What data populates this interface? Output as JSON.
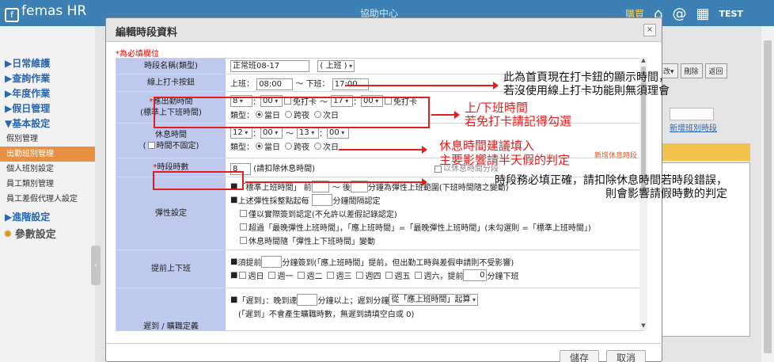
{
  "header": {
    "logo": "femas HR",
    "center": "協助中心",
    "shop": "購買",
    "user": "TEST"
  },
  "sidebar": {
    "items": [
      {
        "label": "▶日常維護"
      },
      {
        "label": "▶查詢作業"
      },
      {
        "label": "▶年度作業"
      },
      {
        "label": "▶假日管理"
      },
      {
        "label": "▼基本設定"
      }
    ],
    "subs": [
      {
        "label": "假別管理",
        "active": false
      },
      {
        "label": "出勤班別管理",
        "active": true
      },
      {
        "label": "個人班別設定",
        "active": false
      },
      {
        "label": "員工類別管理",
        "active": false
      },
      {
        "label": "員工差假代理人設定",
        "active": false
      }
    ],
    "after": {
      "label": "▶進階設定"
    },
    "param": {
      "label": "參數設定"
    }
  },
  "background": {
    "buttons": [
      "確認修改▾",
      "刪除",
      "返回"
    ],
    "link": "新增班別時段"
  },
  "modal": {
    "title": "編輯時段資料",
    "close": "×",
    "required_note": "*為必填欄位",
    "save": "儲存",
    "cancel": "取消"
  },
  "form": {
    "name": {
      "label": "時段名稱(類型)",
      "value": "正常班08-17",
      "type": "上班"
    },
    "punch": {
      "label": "線上打卡按鈕",
      "on_label": "上班：",
      "on_value": "08:00",
      "tilde": "～",
      "off_label": "下班：",
      "off_value": "17:00"
    },
    "required_time": {
      "star": "*",
      "label": "應出勤時間",
      "sub": "(標準上下班時間)",
      "start_h": "8",
      "start_m": "00",
      "free_in": "免打卡",
      "tilde": "～",
      "end_h": "17",
      "end_m": "00",
      "free_out": "免打卡",
      "type_label": "類型：",
      "types": [
        "當日",
        "跨夜",
        "次日"
      ],
      "type_selected": 0
    },
    "rest_time": {
      "label": "休息時間",
      "sub": "時間不固定)",
      "sub_prefix": "(",
      "start_h": "12",
      "start_m": "00",
      "tilde": "～",
      "end_h": "13",
      "end_m": "00",
      "type_label": "類型：",
      "types": [
        "當日",
        "跨夜",
        "次日"
      ],
      "type_selected": 0,
      "link": "新增休息時段"
    },
    "hours": {
      "star": "*",
      "label": "時段時數",
      "value": "8",
      "note": "(請扣除休息時間)",
      "extra": "以休息時間分段"
    },
    "flex": {
      "label": "彈性設定",
      "line1_a": "「標準上班時間」 前",
      "line1_b": "～ 後",
      "line1_c": "分鐘為彈性上班範圍(下班時間隨之變動)",
      "line2_a": "上述彈性採整點起每",
      "line2_b": "分鐘間隔認定",
      "line3": "僅以實際簽到認定(不允許以差假記錄認定)",
      "line4": "超過「最晚彈性上班時間」，「應上班時間」=「最晚彈性上班時間」(未勾選則 =「標準上班時間」)",
      "line5": "休息時間隨「彈性上下班時間」變動"
    },
    "advance": {
      "label": "提前上下班",
      "line1_a": "須提前",
      "line1_b": "分鐘簽到(「應上班時間」提前，但出勤工時與差假申請則不受影響)",
      "days": [
        "週日",
        "週一",
        "週二",
        "週三",
        "週四",
        "週五",
        "週六"
      ],
      "line2_a": "，提前",
      "line2_value": "0",
      "line2_b": "分鐘下班"
    },
    "late": {
      "label": "遲到 / 曠職定義",
      "line1_a": "「遲到」：晚到達",
      "line1_b": "分鐘以上；遲到分鐘",
      "line1_sel": "從「應上班時間」起算",
      "line2": "(「遲到」不會產生曠職時數，無遲到請填空白或 0)"
    }
  },
  "annotations": [
    {
      "text": "此為首頁現在打卡鈕的顯示時間，\n若沒使用線上打卡功能則無須理會",
      "color": "black"
    },
    {
      "text": "上/下班時間\n若免打卡請記得勾選",
      "color": "red"
    },
    {
      "text": "休息時間建議填入\n主要影響請半天假的判定",
      "color": "red"
    },
    {
      "text": "時段務必填正確，請扣除休息時間若時段錯誤，\n則會影響請假時數的判定",
      "color": "black"
    }
  ]
}
